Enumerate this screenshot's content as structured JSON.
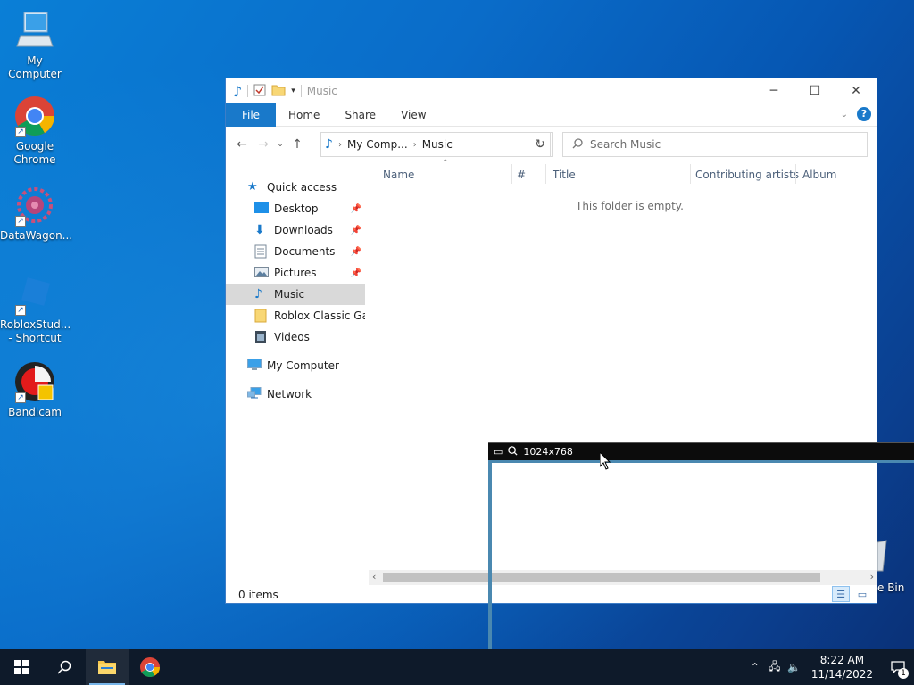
{
  "desktop": {
    "icons": [
      {
        "label": "My Computer"
      },
      {
        "label": "Google Chrome"
      },
      {
        "label": "DataWagon..."
      },
      {
        "label": "RobloxStud... - Shortcut"
      },
      {
        "label": "Bandicam"
      }
    ],
    "recycle_bin_label": "e Bin"
  },
  "explorer": {
    "title": "Music",
    "ribbon": {
      "file_label": "File",
      "tabs": [
        "Home",
        "Share",
        "View"
      ]
    },
    "address": {
      "parts": [
        "My Comp...",
        "Music"
      ]
    },
    "search": {
      "placeholder": "Search Music"
    },
    "nav": {
      "quick_access": "Quick access",
      "items": [
        {
          "label": "Desktop",
          "icon": "desktop-icon",
          "pinned": true
        },
        {
          "label": "Downloads",
          "icon": "downloads-icon",
          "pinned": true
        },
        {
          "label": "Documents",
          "icon": "documents-icon",
          "pinned": true
        },
        {
          "label": "Pictures",
          "icon": "pictures-icon",
          "pinned": true
        },
        {
          "label": "Music",
          "icon": "music-icon",
          "selected": true
        },
        {
          "label": "Roblox Classic Gam",
          "icon": "folder-icon"
        },
        {
          "label": "Videos",
          "icon": "videos-icon"
        }
      ],
      "my_computer": "My Computer",
      "network": "Network"
    },
    "columns": [
      "Name",
      "#",
      "Title",
      "Contributing artists",
      "Album"
    ],
    "empty_message": "This folder is empty.",
    "status": "0 items"
  },
  "recorder": {
    "resolution": "1024x768"
  },
  "taskbar": {
    "time": "8:22 AM",
    "date": "11/14/2022",
    "notification_count": "1"
  },
  "colors": {
    "accent": "#1979ca",
    "taskbar": "#0e1a2a"
  }
}
